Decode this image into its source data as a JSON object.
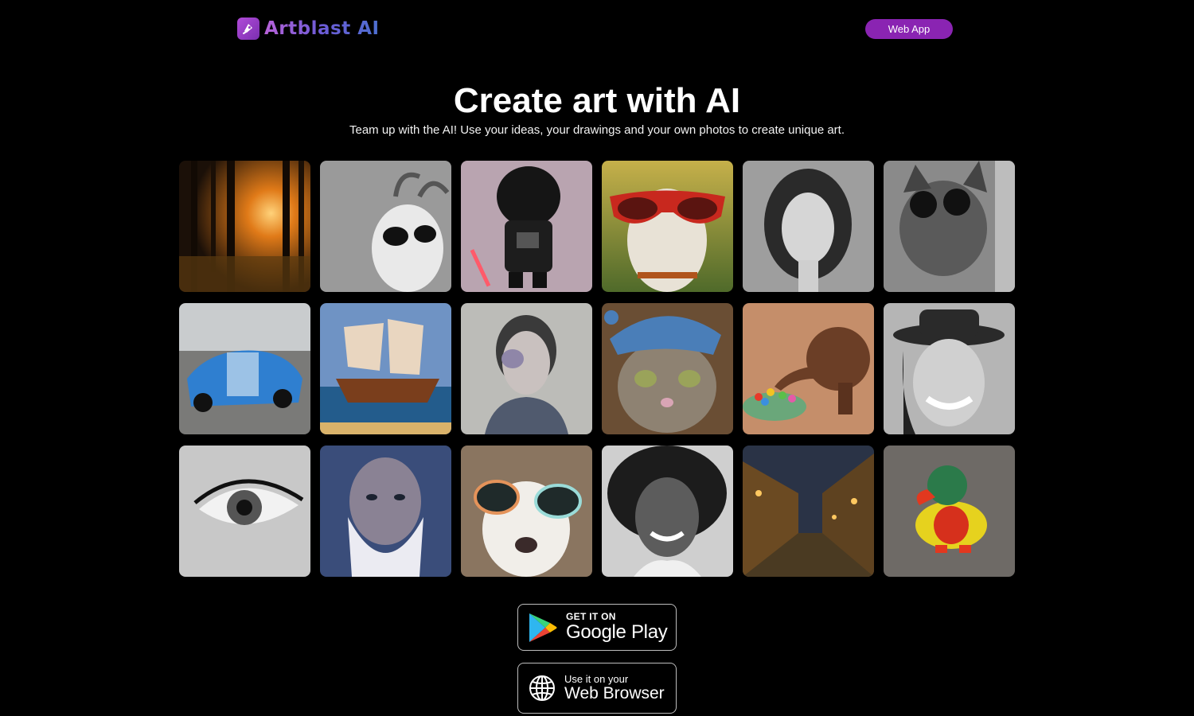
{
  "header": {
    "brand": "Artblast AI",
    "web_app_label": "Web App"
  },
  "hero": {
    "title": "Create art with AI",
    "subtitle": "Team up with the AI! Use your ideas, your drawings and your own photos to create unique art."
  },
  "gallery": {
    "tiles": [
      {
        "subject": "sunset forest"
      },
      {
        "subject": "goat with sunglasses"
      },
      {
        "subject": "darth vader figurine"
      },
      {
        "subject": "dog with red sunglasses"
      },
      {
        "subject": "woman portrait"
      },
      {
        "subject": "cat with sunglasses"
      },
      {
        "subject": "blue sports car"
      },
      {
        "subject": "sailing ship"
      },
      {
        "subject": "painted girl"
      },
      {
        "subject": "cat with blue hat"
      },
      {
        "subject": "wooden elephant with candy"
      },
      {
        "subject": "woman in hat"
      },
      {
        "subject": "eye"
      },
      {
        "subject": "old wizard"
      },
      {
        "subject": "dog with sunglasses"
      },
      {
        "subject": "smiling woman"
      },
      {
        "subject": "night street"
      },
      {
        "subject": "toy duck"
      }
    ]
  },
  "stores": {
    "google_play": {
      "small": "GET IT ON",
      "big": "Google Play"
    },
    "web_browser": {
      "small": "Use it on your",
      "big": "Web Browser"
    }
  }
}
